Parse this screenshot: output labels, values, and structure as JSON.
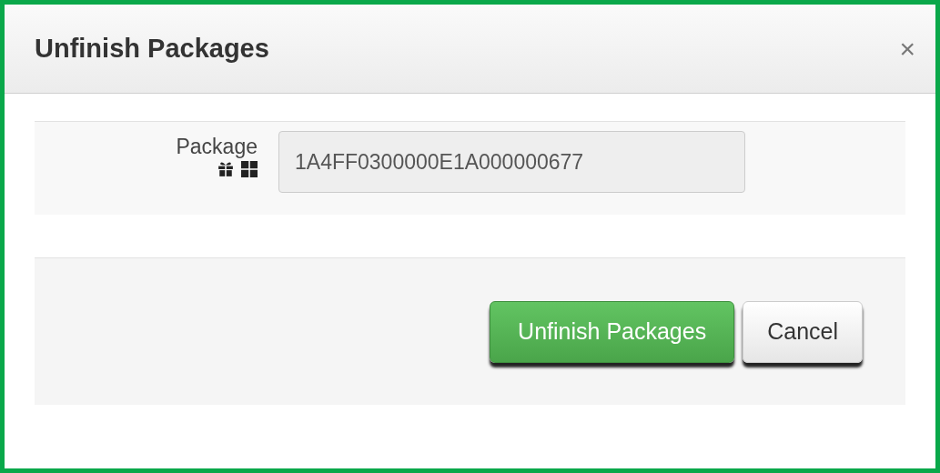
{
  "dialog": {
    "title": "Unfinish Packages",
    "close": "×"
  },
  "fields": [
    {
      "label": "Package",
      "value": "1A4FF0300000E1A000000677",
      "disabled": true
    }
  ],
  "buttons": [
    {
      "label": "Unfinish Packages",
      "kind": "primary"
    },
    {
      "label": "Cancel",
      "kind": "default"
    }
  ]
}
